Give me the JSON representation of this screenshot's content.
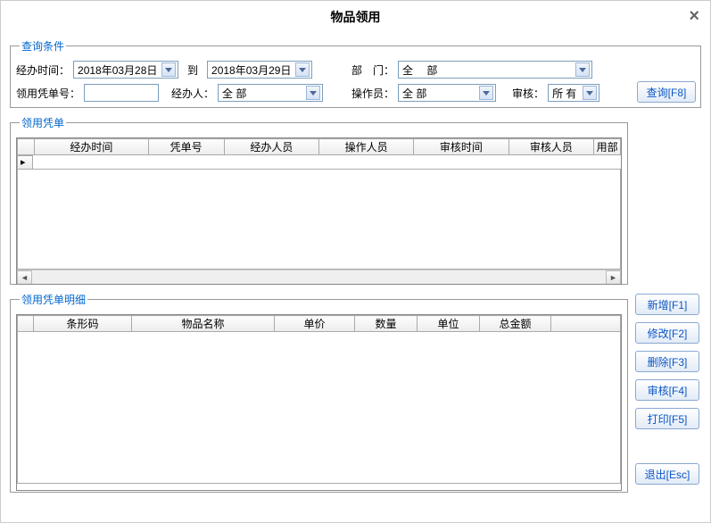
{
  "window": {
    "title": "物品领用"
  },
  "query": {
    "legend": "查询条件",
    "time_label": "经办时间：",
    "date_start": "2018年03月28日",
    "to": "到",
    "date_end": "2018年03月29日",
    "dept_label": "部　门：",
    "dept_value": "全　 部",
    "voucher_no_label": "领用凭单号：",
    "voucher_no_value": "",
    "handler_label": "经办人：",
    "handler_value": "全  部",
    "operator_label": "操作员：",
    "operator_value": "全  部",
    "audit_label": "审核：",
    "audit_value": "所  有"
  },
  "voucher": {
    "legend": "领用凭单",
    "columns": [
      "经办时间",
      "凭单号",
      "经办人员",
      "操作人员",
      "审核时间",
      "审核人员",
      "用部"
    ]
  },
  "detail": {
    "legend": "领用凭单明细",
    "columns": [
      "条形码",
      "物品名称",
      "单价",
      "数量",
      "单位",
      "总金额"
    ]
  },
  "buttons": {
    "query": "查询[F8]",
    "add": "新增[F1]",
    "edit": "修改[F2]",
    "delete": "删除[F3]",
    "audit": "审核[F4]",
    "print": "打印[F5]",
    "exit": "退出[Esc]"
  }
}
